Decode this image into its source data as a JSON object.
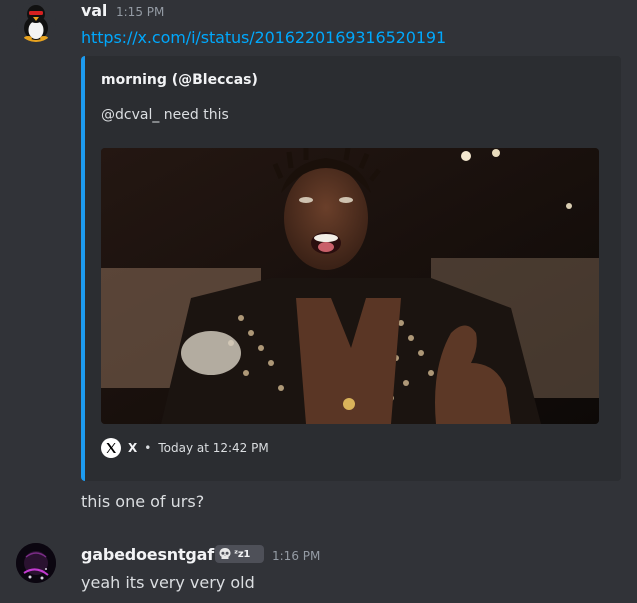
{
  "messages": [
    {
      "username": "val",
      "timestamp": "1:15 PM",
      "link": "https://x.com/i/status/2016220169316520191",
      "embed": {
        "author": "morning (@Bleccas)",
        "description": "@dcval_ need this",
        "footer_provider": "X",
        "footer_separator": "•",
        "footer_time": "Today at 12:42 PM",
        "accent_color": "#1d9bf0"
      },
      "followup_text": "this one of urs?"
    },
    {
      "username": "gabedoesntgaf",
      "badge_text": "ᶻz1",
      "timestamp": "1:16 PM",
      "text": "yeah its very very old"
    }
  ],
  "icons": {
    "val_avatar": "penguin-avatar-icon",
    "gabe_avatar": "dark-purple-avatar-icon",
    "x_logo": "x-logo-icon",
    "badge_icon": "skull-icon"
  },
  "colors": {
    "background": "#313338",
    "embed_background": "#2b2d31",
    "link": "#00a8fc",
    "username": "#f2f3f5",
    "timestamp": "#949ba4",
    "text": "#dbdee1"
  }
}
